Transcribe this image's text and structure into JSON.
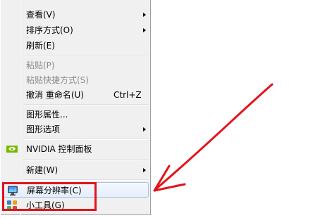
{
  "menu": {
    "view": "查看(V)",
    "sort_by": "排序方式(O)",
    "refresh": "刷新(E)",
    "paste": "粘贴(P)",
    "paste_shortcut": "粘贴快捷方式(S)",
    "undo_rename": "撤消 重命名(U)",
    "undo_shortcut_key": "Ctrl+Z",
    "graphics_properties": "图形属性...",
    "graphics_options": "图形选项",
    "nvidia_control_panel": "NVIDIA 控制面板",
    "new": "新建(W)",
    "screen_resolution": "屏幕分辨率(C)",
    "gadgets": "小工具(G)"
  },
  "icons": {
    "nvidia": "nvidia-icon",
    "screen_resolution": "monitor-icon",
    "gadgets": "gadgets-icon"
  },
  "annotation": {
    "highlight_color": "#e3131b"
  }
}
